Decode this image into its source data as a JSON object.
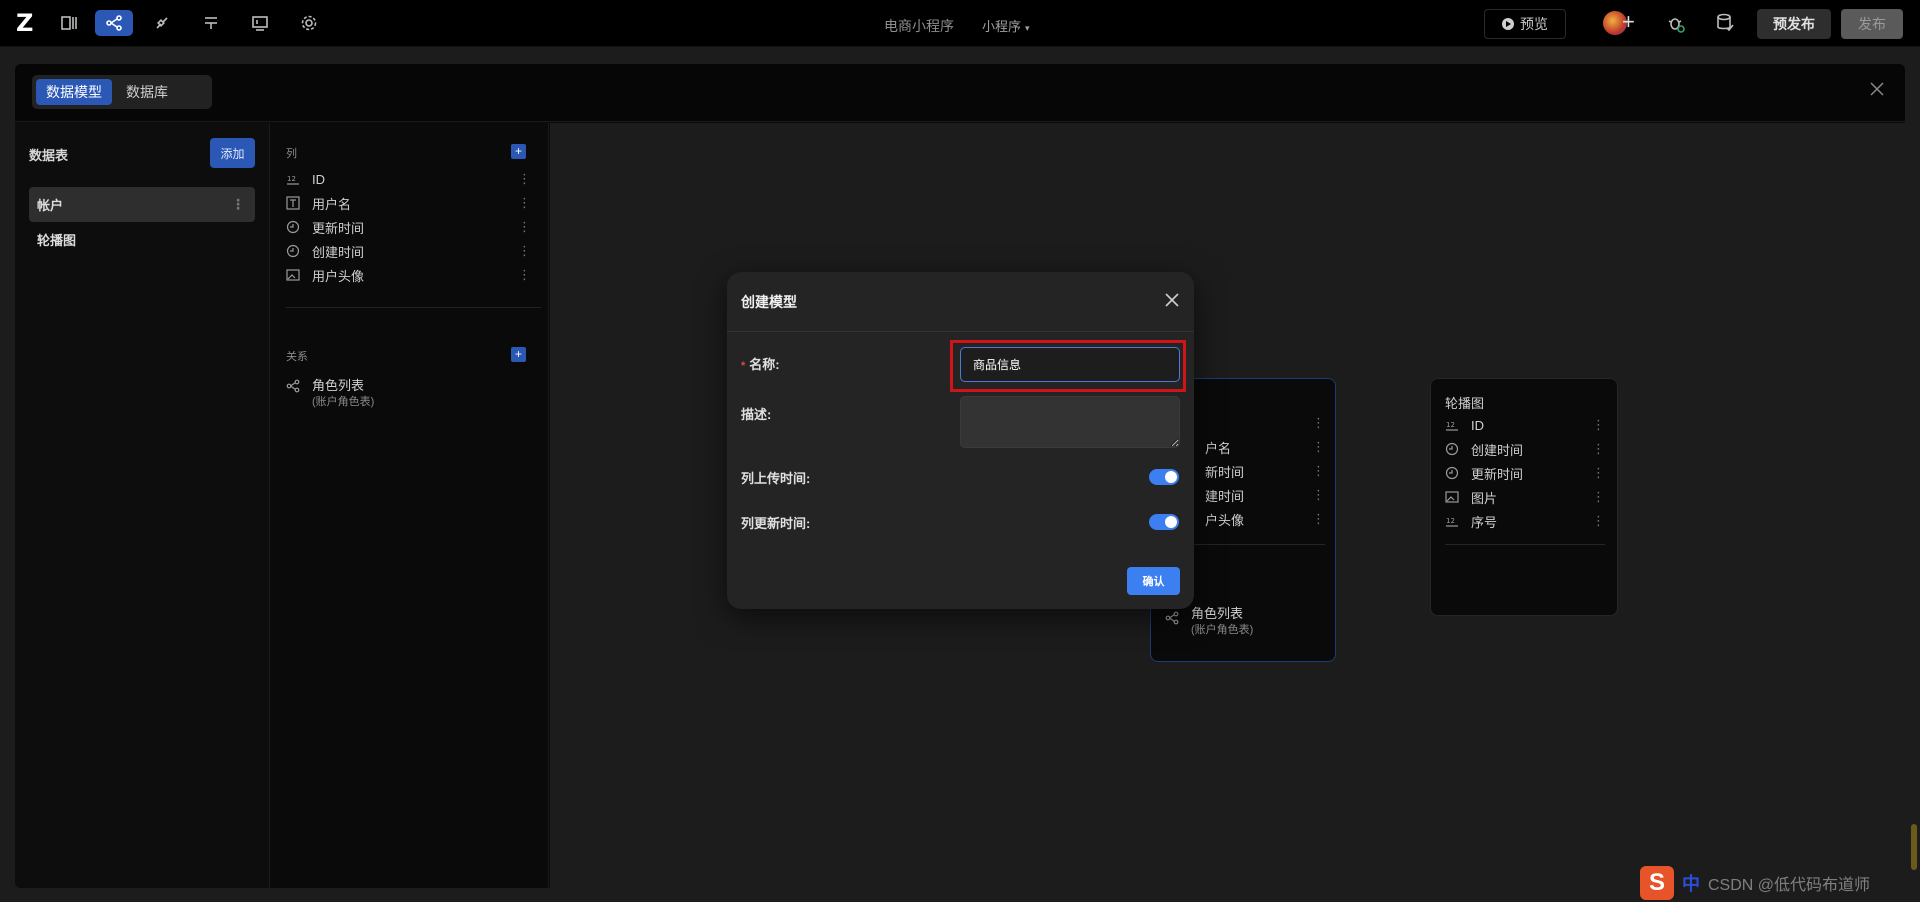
{
  "topbar": {
    "logo": "Z",
    "app_title": "电商小程序",
    "app_type": "小程序",
    "preview_label": "预览",
    "prepublish_label": "预发布",
    "publish_label": "发布"
  },
  "panel": {
    "tabs": [
      {
        "label": "数据模型",
        "active": true
      },
      {
        "label": "数据库",
        "active": false
      }
    ]
  },
  "tables": {
    "title": "数据表",
    "add_label": "添加",
    "items": [
      {
        "label": "帐户",
        "active": true
      },
      {
        "label": "轮播图",
        "active": false
      }
    ]
  },
  "columns": {
    "columns_title": "列",
    "items": [
      {
        "label": "ID",
        "icon": "number-icon"
      },
      {
        "label": "用户名",
        "icon": "text-icon"
      },
      {
        "label": "更新时间",
        "icon": "clock-icon"
      },
      {
        "label": "创建时间",
        "icon": "clock-icon"
      },
      {
        "label": "用户头像",
        "icon": "image-icon"
      }
    ],
    "relations_title": "关系",
    "relations": [
      {
        "name": "角色列表",
        "sub": "(账户角色表)"
      }
    ]
  },
  "canvas": {
    "account_node": {
      "rows": [
        "户名",
        "新时间",
        "建时间",
        "户头像"
      ],
      "relation_name": "角色列表",
      "relation_sub": "(账户角色表)"
    },
    "carousel_node": {
      "title": "轮播图",
      "rows": [
        {
          "label": "ID",
          "icon": "number-icon"
        },
        {
          "label": "创建时间",
          "icon": "clock-icon"
        },
        {
          "label": "更新时间",
          "icon": "clock-icon"
        },
        {
          "label": "图片",
          "icon": "image-icon"
        },
        {
          "label": "序号",
          "icon": "number-icon"
        }
      ]
    }
  },
  "modal": {
    "title": "创建模型",
    "name_label": "名称:",
    "name_required_mark": "*",
    "name_value": "商品信息",
    "desc_label": "描述:",
    "desc_value": "",
    "toggle_upload_label": "列上传时间:",
    "toggle_upload_on": true,
    "toggle_update_label": "列更新时间:",
    "toggle_update_on": true,
    "confirm_label": "确认"
  },
  "overlay": {
    "ime_logo": "S",
    "ime_mode": "中",
    "watermark": "CSDN @低代码布道师"
  },
  "colors": {
    "accent": "#2b58b5",
    "primary_button": "#3b7ff0",
    "highlight_box": "#d0141a"
  }
}
